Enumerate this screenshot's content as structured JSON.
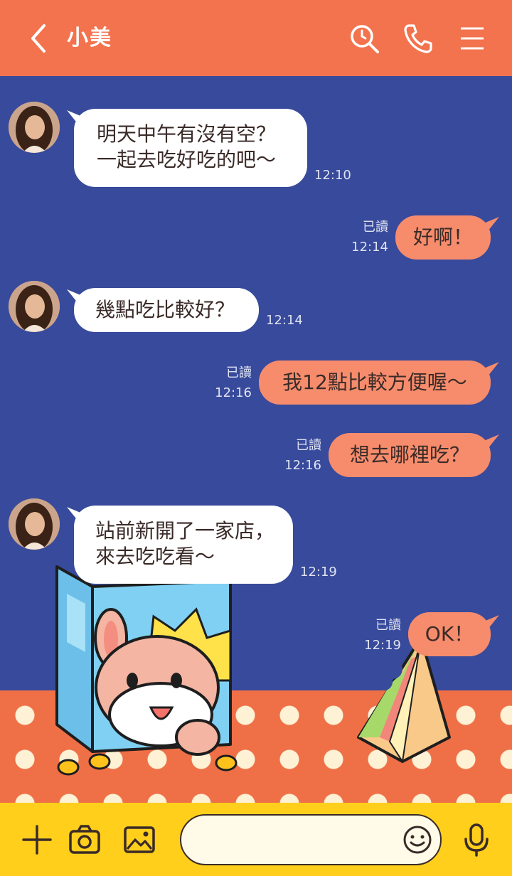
{
  "header": {
    "title": "小美"
  },
  "icons": {
    "back": "chevron-left-icon",
    "search": "search-icon",
    "call": "phone-icon",
    "menu": "hamburger-menu-icon"
  },
  "messages": [
    {
      "dir": "in",
      "text": "明天中午有沒有空？\n一起去吃好吃的吧〜",
      "time": "12:10"
    },
    {
      "dir": "out",
      "text": "好啊！",
      "status": "已讀",
      "time": "12:14"
    },
    {
      "dir": "in",
      "text": "幾點吃比較好？",
      "time": "12:14"
    },
    {
      "dir": "out",
      "text": "我12點比較方便喔〜",
      "status": "已讀",
      "time": "12:16"
    },
    {
      "dir": "out",
      "text": "想去哪裡吃？",
      "status": "已讀",
      "time": "12:16"
    },
    {
      "dir": "in",
      "text": "站前新開了一家店，\n來去吃吃看〜",
      "time": "12:19"
    },
    {
      "dir": "out",
      "text": "OK！",
      "status": "已讀",
      "time": "12:19"
    }
  ],
  "input": {
    "placeholder": "",
    "value": ""
  },
  "toolbar": {
    "add": "plus-icon",
    "camera": "camera-icon",
    "image": "image-icon",
    "emoji": "smiley-icon",
    "mic": "microphone-icon"
  },
  "colors": {
    "header": "#f2734e",
    "background": "#384a9b",
    "incoming": "#ffffff",
    "outgoing": "#f68c6c",
    "inputbar": "#ffcf1c"
  }
}
